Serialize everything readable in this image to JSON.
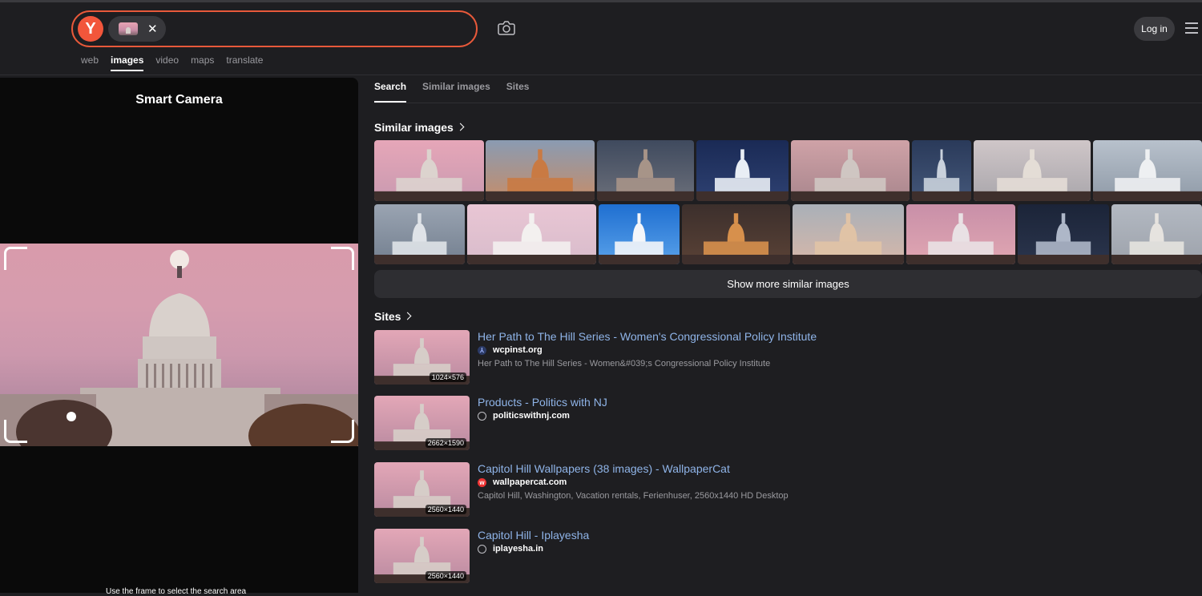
{
  "header": {
    "logo_letter": "Y",
    "chip_close": "✕",
    "login_label": "Log in",
    "nav_tabs": [
      {
        "label": "web",
        "active": false
      },
      {
        "label": "images",
        "active": true
      },
      {
        "label": "video",
        "active": false
      },
      {
        "label": "maps",
        "active": false
      },
      {
        "label": "translate",
        "active": false
      }
    ]
  },
  "left_panel": {
    "title": "Smart Camera",
    "bottom_hint": "Use the frame to select the search area"
  },
  "right_tabs": [
    {
      "label": "Search",
      "active": true
    },
    {
      "label": "Similar images",
      "active": false
    },
    {
      "label": "Sites",
      "active": false
    }
  ],
  "similar_section": {
    "heading": "Similar images",
    "show_more_label": "Show more similar images"
  },
  "sites_section": {
    "heading": "Sites",
    "items": [
      {
        "title": "Her Path to The Hill Series - Women's Congressional Policy Institute",
        "domain": "wcpinst.org",
        "favicon": "wcpi-icon",
        "size": "1024×576",
        "description": "Her Path to The Hill Series - Women&#039;s Congressional Policy Institute"
      },
      {
        "title": "Products - Politics with NJ",
        "domain": "politicswithnj.com",
        "favicon": "globe-icon",
        "size": "2662×1590",
        "description": ""
      },
      {
        "title": "Capitol Hill Wallpapers (38 images) - WallpaperCat",
        "domain": "wallpapercat.com",
        "favicon": "wallpapercat-icon",
        "size": "2560×1440",
        "description": "Capitol Hill, Washington, Vacation rentals, Ferienhuser, 2560x1440 HD Desktop"
      },
      {
        "title": "Capitol Hill - Iplayesha",
        "domain": "iplayesha.in",
        "favicon": "globe-icon",
        "size": "2560×1440",
        "description": ""
      }
    ]
  },
  "colors": {
    "accent": "#e8593a",
    "logo": "#f2563b",
    "link": "#8fb4e8",
    "background": "#1e1e21"
  }
}
